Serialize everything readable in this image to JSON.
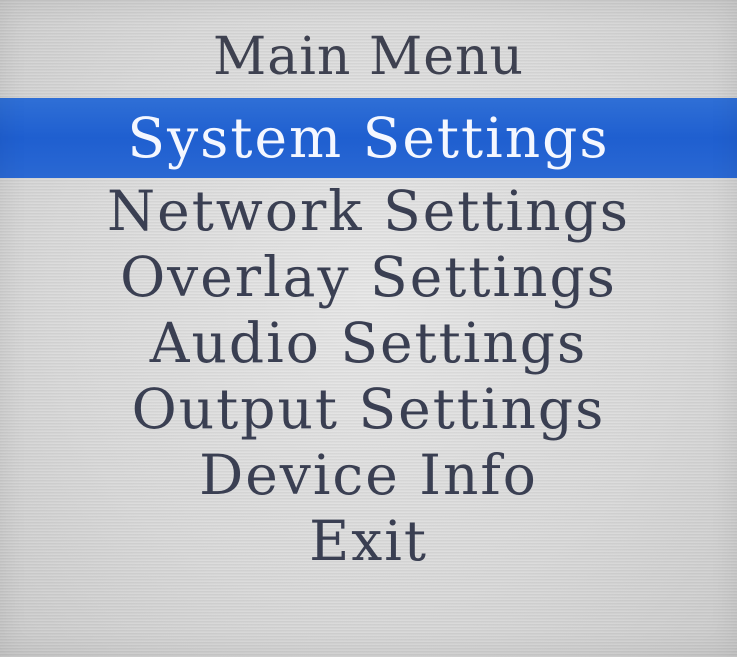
{
  "menu": {
    "title": "Main Menu",
    "items": [
      {
        "label": "System Settings",
        "selected": true
      },
      {
        "label": "Network Settings",
        "selected": false
      },
      {
        "label": "Overlay Settings",
        "selected": false
      },
      {
        "label": "Audio Settings",
        "selected": false
      },
      {
        "label": "Output Settings",
        "selected": false
      },
      {
        "label": "Device Info",
        "selected": false
      },
      {
        "label": "Exit",
        "selected": false
      }
    ]
  },
  "colors": {
    "highlight": "#1f5fd0",
    "highlight_text": "#f4f7ff",
    "text": "#3a3f52",
    "background": "#d9d9d9"
  }
}
